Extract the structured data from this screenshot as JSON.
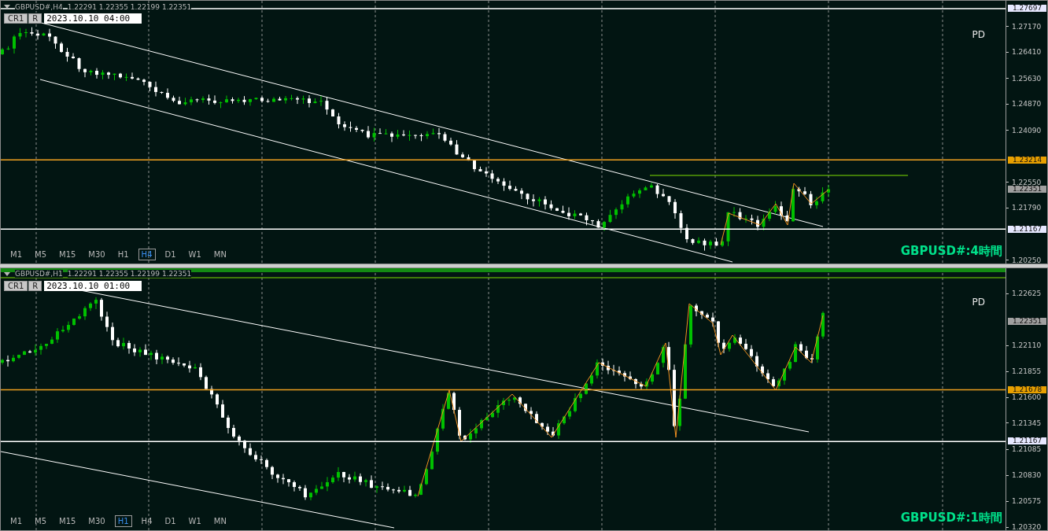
{
  "panes": [
    {
      "symbol": "GBPUSD#,H4",
      "ohlc": "1.22291 1.22355 1.22199 1.22351",
      "buttons": [
        "CR1",
        "R"
      ],
      "date": "2023.10.10 04:00",
      "marker": "PD",
      "title": "GBPUSD#:4時間",
      "timeframes": [
        {
          "label": "M1",
          "selected": false
        },
        {
          "label": "M5",
          "selected": false
        },
        {
          "label": "M15",
          "selected": false
        },
        {
          "label": "M30",
          "selected": false
        },
        {
          "label": "H1",
          "selected": false
        },
        {
          "label": "H4",
          "selected": true
        },
        {
          "label": "D1",
          "selected": false
        },
        {
          "label": "W1",
          "selected": false
        },
        {
          "label": "MN",
          "selected": false
        }
      ],
      "ticks": [
        "1.27170",
        "1.26410",
        "1.25630",
        "1.24870",
        "1.24090",
        "1.22550",
        "1.21790",
        "1.20250"
      ],
      "levels": [
        {
          "price": "1.27697",
          "kind": "support"
        },
        {
          "price": "1.23214",
          "kind": "alert"
        },
        {
          "price": "1.22351",
          "kind": "bid"
        },
        {
          "price": "1.21167",
          "kind": "support"
        }
      ]
    },
    {
      "symbol": "GBPUSD#,H1",
      "ohlc": "1.22291 1.22355 1.22199 1.22351",
      "buttons": [
        "CR1",
        "R"
      ],
      "date": "2023.10.10 01:00",
      "marker": "PD",
      "title": "GBPUSD#:1時間",
      "timeframes": [
        {
          "label": "M1",
          "selected": false
        },
        {
          "label": "M5",
          "selected": false
        },
        {
          "label": "M15",
          "selected": false
        },
        {
          "label": "M30",
          "selected": false
        },
        {
          "label": "H1",
          "selected": true
        },
        {
          "label": "H4",
          "selected": false
        },
        {
          "label": "D1",
          "selected": false
        },
        {
          "label": "W1",
          "selected": false
        },
        {
          "label": "MN",
          "selected": false
        }
      ],
      "ticks": [
        "1.22625",
        "1.22110",
        "1.21855",
        "1.21600",
        "1.21345",
        "1.21085",
        "1.20830",
        "1.20575",
        "1.20320"
      ],
      "levels": [
        {
          "price": "1.22351",
          "kind": "bid"
        },
        {
          "price": "1.21678",
          "kind": "alert"
        },
        {
          "price": "1.21167",
          "kind": "support"
        }
      ]
    }
  ]
}
